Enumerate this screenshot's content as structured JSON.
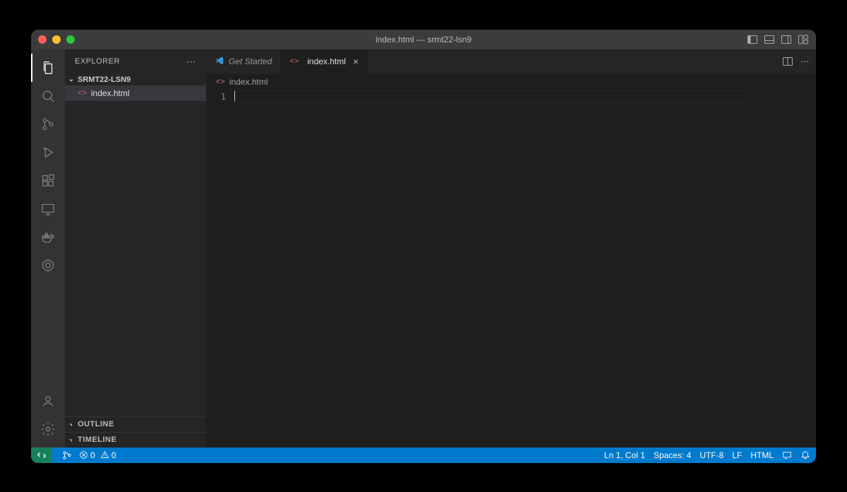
{
  "window": {
    "title": "index.html — srmt22-lsn9"
  },
  "sidebar": {
    "title": "Explorer",
    "root": "SRMT22-LSN9",
    "file": "index.html",
    "outline": "Outline",
    "timeline": "Timeline"
  },
  "tabs": {
    "getstarted": "Get Started",
    "file": "index.html"
  },
  "breadcrumb": {
    "file": "index.html"
  },
  "editor": {
    "line1": "1"
  },
  "status": {
    "errors": "0",
    "warnings": "0",
    "cursor": "Ln 1, Col 1",
    "spaces": "Spaces: 4",
    "encoding": "UTF-8",
    "eol": "LF",
    "lang": "HTML"
  }
}
